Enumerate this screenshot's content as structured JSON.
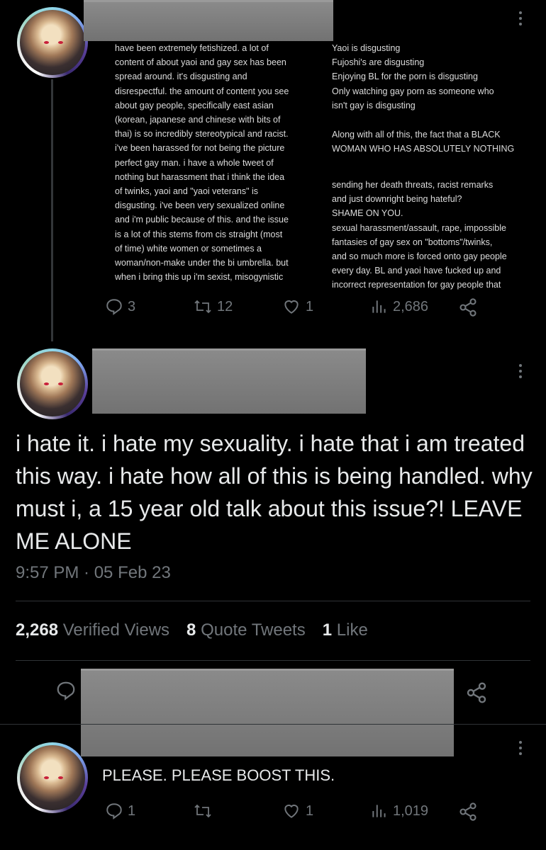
{
  "post1": {
    "essay_left": "have been extremely fetishized. a lot of\ncontent of about yaoi and gay sex has been\nspread around. it's disgusting and\ndisrespectful. the amount of content you see\nabout gay people, specifically east asian\n(korean, japanese and chinese with bits of\nthai) is so incredibly stereotypical and racist.\ni've been harassed for not being the picture\nperfect gay man. i have a whole tweet of\nnothing but harassment that i think the idea\nof twinks, yaoi and \"yaoi veterans\" is\ndisgusting. i've been very sexualized online\nand i'm public because of this. and the issue\nis a lot of this stems from cis straight (most\nof time) white women or sometimes a\nwoman/non-make under the bi umbrella. but\nwhen i bring this up i'm sexist, misogynistic",
    "essay_right_a": "Yaoi is disgusting\nFujoshi's are disgusting\nEnjoying BL for the porn is disgusting\nOnly watching gay porn as someone who\nisn't gay is disgusting",
    "essay_right_b": "Along with all of this, the fact that a BLACK\nWOMAN WHO HAS ABSOLUTELY NOTHING",
    "essay_right_c": "sending her death threats, racist remarks\nand just downright being hateful?\nSHAME ON YOU.\nsexual harassment/assault, rape, impossible\nfantasies of gay sex on \"bottoms\"/twinks,\nand so much more is forced onto gay people\nevery day. BL and yaoi have fucked up and\nincorrect representation for gay people that",
    "replies": "3",
    "retweets": "12",
    "likes": "1",
    "views": "2,686"
  },
  "post2": {
    "text": "i hate it. i hate my sexuality. i hate that i am treated this way. i hate how all of this is being handled. why must i, a 15 year old talk about this issue?! LEAVE ME ALONE",
    "time": "9:57 PM · 05 Feb 23",
    "views_count": "2,268",
    "views_label": "Verified Views",
    "quotes_count": "8",
    "quotes_label": "Quote Tweets",
    "likes_count": "1",
    "likes_label": "Like"
  },
  "post3": {
    "text": "PLEASE. PLEASE BOOST THIS.",
    "replies": "1",
    "likes": "1",
    "views": "1,019"
  },
  "icons": [
    "more-icon",
    "reply-icon",
    "retweet-icon",
    "like-icon",
    "views-icon",
    "share-icon"
  ],
  "colors": {
    "background": "#000000",
    "text": "#e7e9ea",
    "muted": "#71767b",
    "redaction": "#808080"
  }
}
